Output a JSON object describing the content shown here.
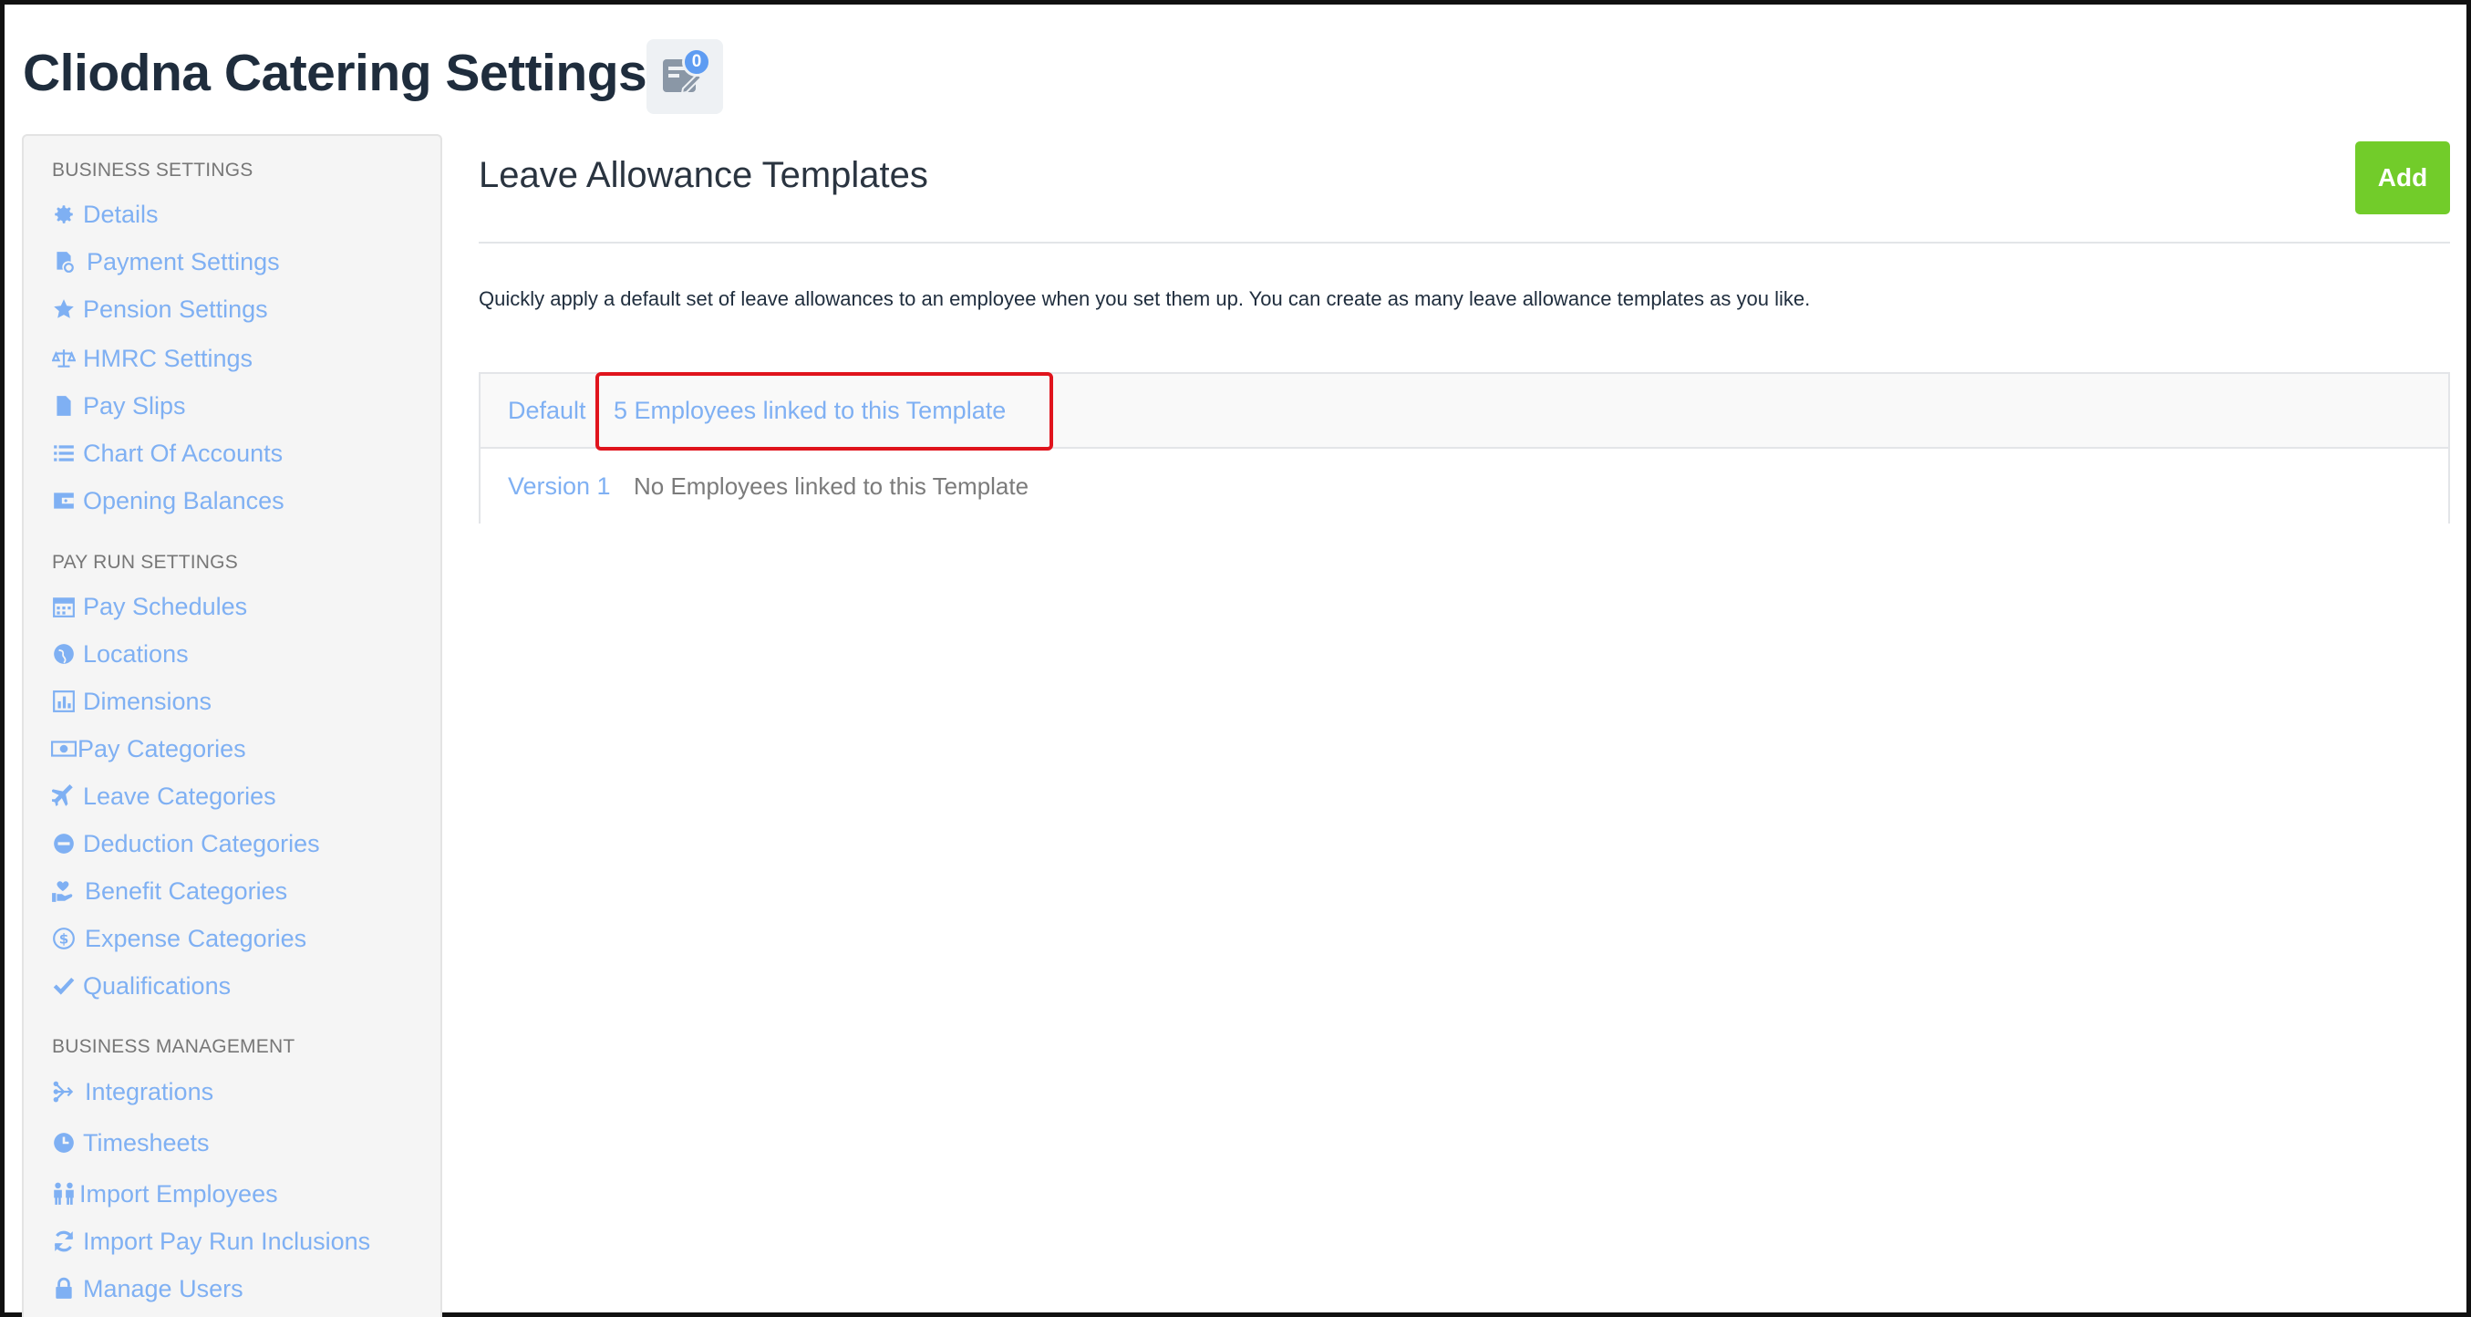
{
  "header": {
    "title": "Cliodna Catering Settings",
    "notes_badge": "0",
    "notes_icon": "notes-icon"
  },
  "sidebar": {
    "sections": [
      {
        "label": "BUSINESS SETTINGS",
        "items": [
          {
            "label": "Details",
            "icon": "gear-icon"
          },
          {
            "label": "Payment Settings",
            "icon": "payment-icon"
          },
          {
            "label": "Pension Settings",
            "icon": "star-icon"
          },
          {
            "label": "HMRC Settings",
            "icon": "scales-icon"
          },
          {
            "label": "Pay Slips",
            "icon": "file-icon"
          },
          {
            "label": "Chart Of Accounts",
            "icon": "list-icon"
          },
          {
            "label": "Opening Balances",
            "icon": "wallet-icon"
          }
        ]
      },
      {
        "label": "PAY RUN SETTINGS",
        "items": [
          {
            "label": "Pay Schedules",
            "icon": "calendar-icon"
          },
          {
            "label": "Locations",
            "icon": "globe-icon"
          },
          {
            "label": "Dimensions",
            "icon": "bar-chart-icon"
          },
          {
            "label": "Pay Categories",
            "icon": "money-icon"
          },
          {
            "label": "Leave Categories",
            "icon": "plane-icon"
          },
          {
            "label": "Deduction Categories",
            "icon": "minus-circle-icon"
          },
          {
            "label": "Benefit Categories",
            "icon": "hand-heart-icon"
          },
          {
            "label": "Expense Categories",
            "icon": "dollar-circle-icon"
          },
          {
            "label": "Qualifications",
            "icon": "check-icon"
          }
        ]
      },
      {
        "label": "BUSINESS MANAGEMENT",
        "items": [
          {
            "label": "Integrations",
            "icon": "integration-icon"
          },
          {
            "label": "Timesheets",
            "icon": "clock-icon"
          },
          {
            "label": "Import Employees",
            "icon": "people-icon"
          },
          {
            "label": "Import Pay Run Inclusions",
            "icon": "refresh-icon"
          },
          {
            "label": "Manage Users",
            "icon": "lock-icon"
          }
        ]
      }
    ]
  },
  "main": {
    "title": "Leave Allowance Templates",
    "add_label": "Add",
    "description": "Quickly apply a default set of leave allowances to an employee when you set them up. You can create as many leave allowance templates as you like.",
    "templates": [
      {
        "name": "Default",
        "employees": "5 Employees linked to this Template"
      },
      {
        "name": "Version 1",
        "employees": "No Employees linked to this Template"
      }
    ]
  },
  "colors": {
    "link": "#7fb0f3",
    "add_button": "#72cc2a",
    "highlight": "#e0141d",
    "heading": "#1f2d3d"
  }
}
